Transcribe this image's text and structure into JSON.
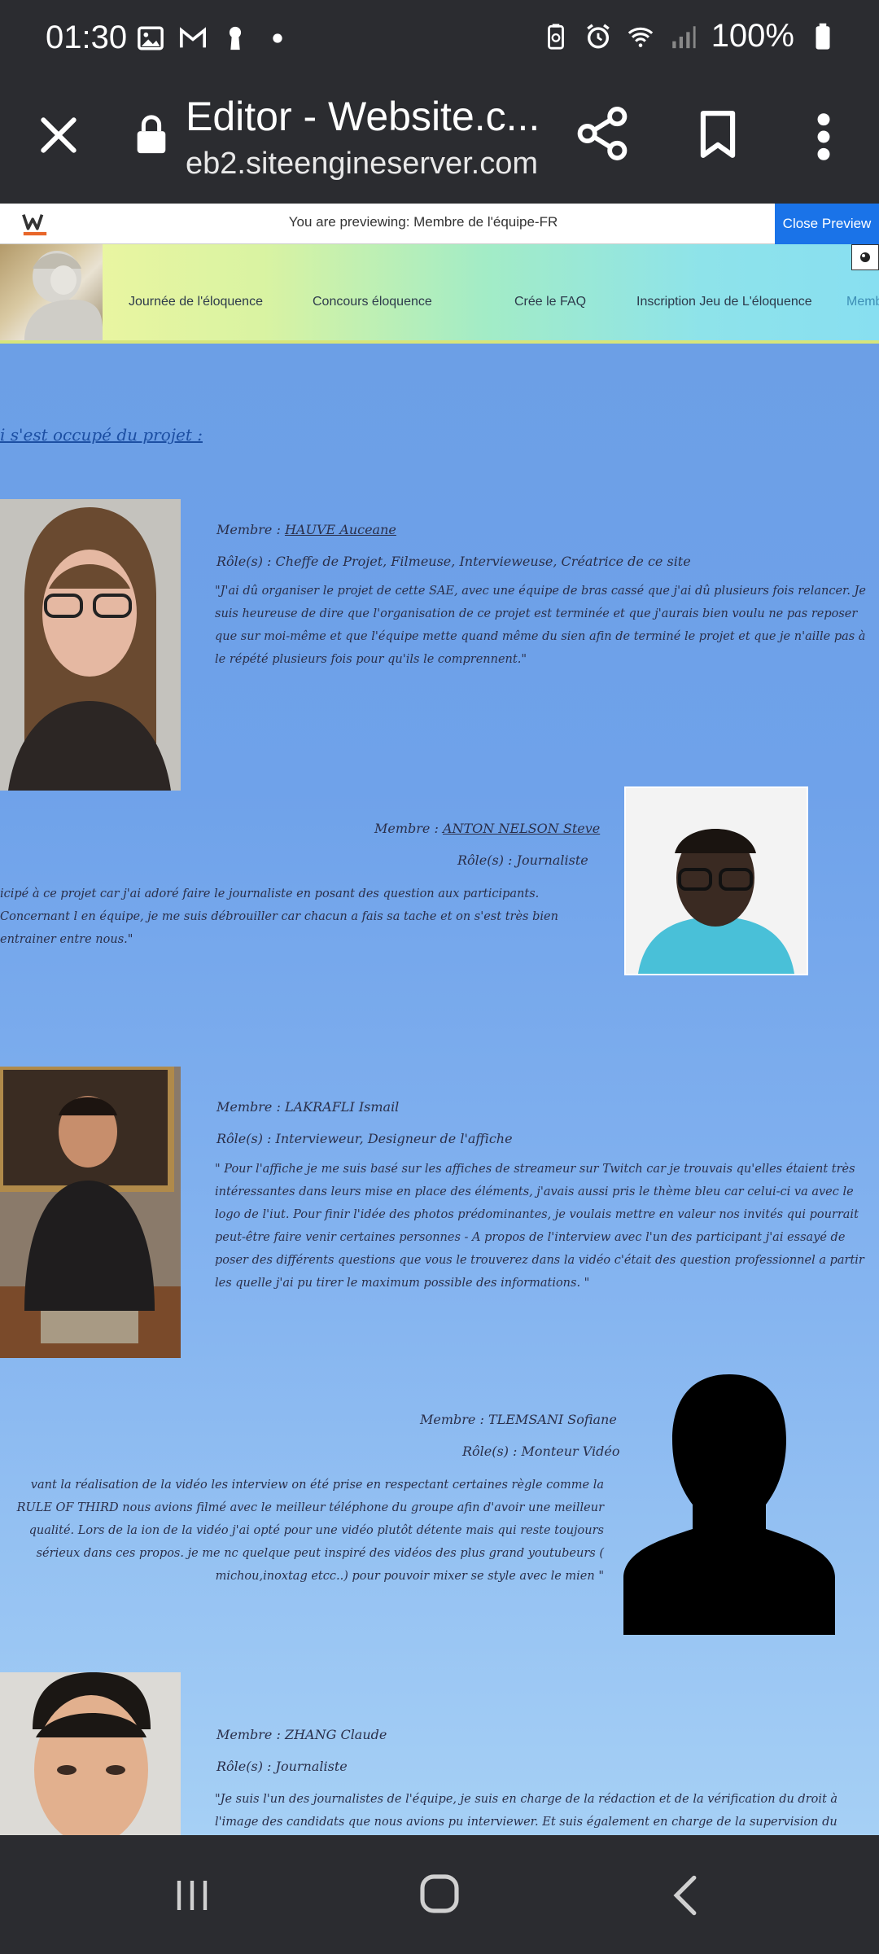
{
  "status_bar": {
    "time": "01:30",
    "battery": "100%",
    "left_icons": [
      "image-icon",
      "gmail-icon",
      "keyhole-icon",
      "dot-icon"
    ],
    "right_icons": [
      "battery-saver-icon",
      "alarm-icon",
      "wifi-icon",
      "signal-icon",
      "battery-icon"
    ]
  },
  "browser": {
    "title": "Editor - Website.c...",
    "url": "eb2.siteengineserver.com"
  },
  "preview_bar": {
    "text": "You are previewing: Membre de l'équipe-FR",
    "close_label": "Close Preview"
  },
  "site_nav": {
    "items": [
      "Journée de l'éloquence",
      "Concours éloquence",
      "Crée le FAQ",
      "Inscription Jeu de L'éloquence",
      "Memb"
    ]
  },
  "content": {
    "heading": "i s'est occupé du projet :",
    "members": [
      {
        "name_prefix": "Membre : ",
        "name": "HAUVE Auceane",
        "role": "Rôle(s) : Cheffe de Projet, Filmeuse, Intervieweuse, Créatrice de ce site",
        "quote": "\"J'ai dû organiser le projet de cette SAE, avec une équipe de bras cassé que j'ai dû plusieurs fois relancer. Je suis heureuse de dire que l'organisation de ce projet est terminée et que j'aurais bien voulu ne pas reposer que sur moi-même et que l'équipe mette quand même du sien afin de terminé le projet et que je n'aille pas à le répété plusieurs fois pour qu'ils le comprennent.\""
      },
      {
        "name_prefix": "Membre : ",
        "name": "ANTON NELSON Steve",
        "role": "Rôle(s) : Journaliste",
        "quote": "icipé à ce projet car j'ai adoré faire le journaliste en posant des question aux participants. Concernant l en équipe, je me suis débrouiller car chacun a fais sa tache et on s'est très bien entrainer entre nous.\""
      },
      {
        "name_prefix": "Membre : ",
        "name": "LAKRAFLI Ismail",
        "role": "Rôle(s) : Intervieweur, Designeur de l'affiche",
        "quote": "\" Pour l'affiche je me suis basé sur les affiches de streameur sur Twitch car je trouvais qu'elles étaient très intéressantes dans leurs mise en place des éléments, j'avais aussi pris le thème bleu car celui-ci va avec le logo de l'iut. Pour finir l'idée des photos prédominantes, je voulais mettre en valeur nos invités qui pourrait peut-être faire venir certaines personnes - A propos de l'interview avec l'un des participant j'ai essayé de poser des différents questions que vous le trouverez dans la vidéo c'était des question professionnel a partir les quelle j'ai pu tirer le maximum possible des informations. \""
      },
      {
        "name_prefix": "Membre : ",
        "name": "TLEMSANI Sofiane",
        "role": "Rôle(s) : Monteur Vidéo",
        "quote": "vant la réalisation de la vidéo les interview on été prise en respectant certaines règle comme la RULE OF THIRD nous avions filmé avec le meilleur téléphone du groupe afin d'avoir une meilleur qualité. Lors de la ion de la vidéo j'ai opté pour une vidéo plutôt détente mais qui reste toujours sérieux dans ces propos. je me nc quelque peut inspiré des vidéos des plus grand youtubeurs ( michou,inoxtag etcc..) pour pouvoir mixer se style avec le mien \""
      },
      {
        "name_prefix": "Membre : ",
        "name": "ZHANG Claude",
        "role": "Rôle(s) :  Journaliste",
        "quote": "\"Je suis l'un des journalistes de l'équipe, je suis en charge de la rédaction et de la vérification du droit à l'image des candidats que nous avions pu interviewer. Et suis également en charge de la supervision du sondage qui fût adressé"
      }
    ]
  },
  "colors": {
    "status_bg": "#2b2c30",
    "close_preview_bg": "#1a73e8",
    "content_top": "#6c9fe6",
    "content_bottom": "#a6d0f5",
    "script_text": "#2a2f4a",
    "heading_link": "#1c4fa3"
  }
}
